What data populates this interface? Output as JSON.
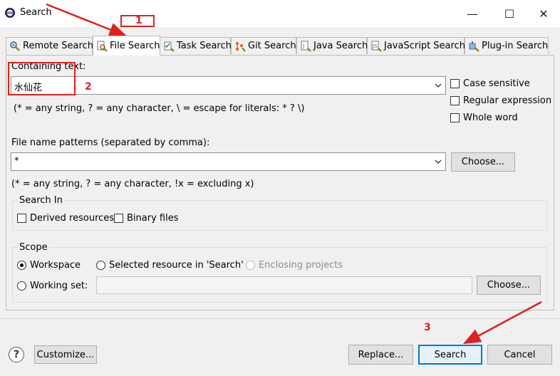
{
  "window": {
    "title": "Search",
    "controls": {
      "minimize": "—",
      "maximize": "☐",
      "close": "✕"
    }
  },
  "tabs": [
    {
      "label": "Remote Search",
      "icon": "remote-search-icon",
      "active": false
    },
    {
      "label": "File Search",
      "icon": "file-search-icon",
      "active": true
    },
    {
      "label": "Task Search",
      "icon": "task-search-icon",
      "active": false
    },
    {
      "label": "Git Search",
      "icon": "git-search-icon",
      "active": false
    },
    {
      "label": "Java Search",
      "icon": "java-search-icon",
      "active": false
    },
    {
      "label": "JavaScript Search",
      "icon": "javascript-search-icon",
      "active": false
    },
    {
      "label": "Plug-in Search",
      "icon": "plugin-search-icon",
      "active": false
    }
  ],
  "containing": {
    "label": "Containing text:",
    "value": "水仙花",
    "hint": "(* = any string, ? = any character, \\ = escape for literals: * ? \\)"
  },
  "options": {
    "case_sensitive": {
      "label": "Case sensitive",
      "checked": false
    },
    "regex": {
      "label": "Regular expression",
      "checked": false
    },
    "whole_word": {
      "label": "Whole word",
      "checked": false
    }
  },
  "file_patterns": {
    "label": "File name patterns (separated by comma):",
    "value": "*",
    "choose_label": "Choose...",
    "hint": "(* = any string, ? = any character, !x = excluding x)"
  },
  "search_in": {
    "title": "Search In",
    "derived": {
      "label": "Derived resources",
      "checked": false
    },
    "binary": {
      "label": "Binary files",
      "checked": false
    }
  },
  "scope": {
    "title": "Scope",
    "workspace": {
      "label": "Workspace",
      "checked": true
    },
    "selected": {
      "label": "Selected resource in 'Search'",
      "checked": false
    },
    "enclosing": {
      "label": "Enclosing projects",
      "checked": false,
      "disabled": true
    },
    "working_set": {
      "label": "Working set:",
      "checked": false,
      "value": ""
    },
    "choose_label": "Choose..."
  },
  "footer": {
    "help": "?",
    "customize": "Customize...",
    "replace": "Replace...",
    "search": "Search",
    "cancel": "Cancel"
  },
  "annotations": {
    "n1": "1",
    "n2": "2",
    "n3": "3"
  },
  "colors": {
    "accent": "#0078d7",
    "annotation": "#e02020"
  }
}
